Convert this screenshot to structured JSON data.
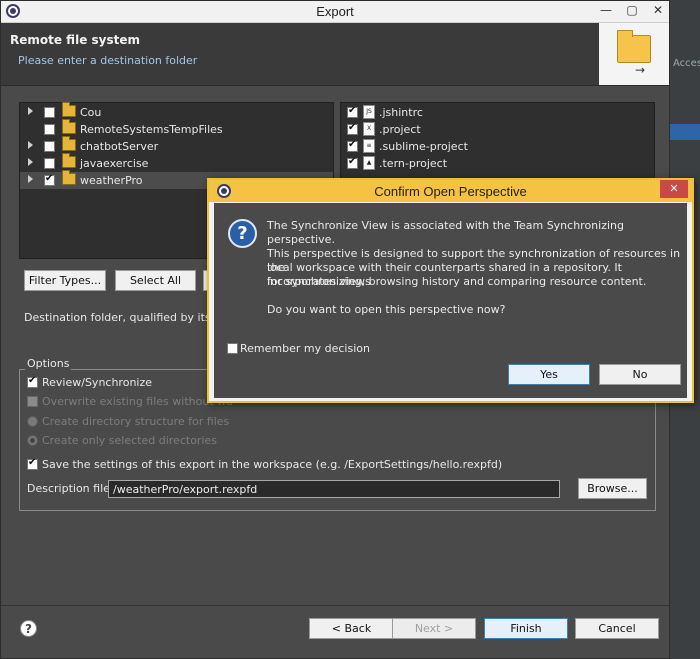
{
  "window": {
    "title": "Export",
    "controls": [
      "—",
      "▢",
      "✕"
    ]
  },
  "header": {
    "title": "Remote file system",
    "subtitle": "Please enter a destination folder"
  },
  "background": {
    "partial_text": "Acces"
  },
  "tree": {
    "items": [
      {
        "label": "Cou",
        "checked": false,
        "expandable": true
      },
      {
        "label": "RemoteSystemsTempFiles",
        "checked": false,
        "expandable": false
      },
      {
        "label": "chatbotServer",
        "checked": false,
        "expandable": true
      },
      {
        "label": "javaexercise",
        "checked": false,
        "expandable": true
      },
      {
        "label": "weatherPro",
        "checked": true,
        "expandable": true,
        "selected": true
      }
    ]
  },
  "files": {
    "items": [
      {
        "label": ".jshintrc",
        "checked": true,
        "icon": "js-file-icon"
      },
      {
        "label": ".project",
        "checked": true,
        "icon": "xml-file-icon"
      },
      {
        "label": ".sublime-project",
        "checked": true,
        "icon": "text-file-icon"
      },
      {
        "label": ".tern-project",
        "checked": true,
        "icon": "tern-file-icon"
      }
    ]
  },
  "buttons": {
    "filter_types": "Filter Types...",
    "select_all": "Select All",
    "back": "< Back",
    "next": "Next >",
    "finish": "Finish",
    "cancel": "Cancel",
    "browse": "Browse..."
  },
  "destination_label": "Destination folder, qualified by its re",
  "options": {
    "legend": "Options",
    "review_sync": "Review/Synchronize",
    "overwrite": "Overwrite existing files without wa",
    "create_structure": "Create directory structure for files",
    "create_selected": "Create only selected directories",
    "save_settings": "Save the settings of this export in the workspace (e.g. /ExportSettings/hello.rexpfd)",
    "description_label": "Description file:",
    "description_value": "/weatherPro/export.rexpfd"
  },
  "dialog": {
    "title": "Confirm Open Perspective",
    "close": "✕",
    "line1": "The Synchronize View is associated with the Team Synchronizing perspective.",
    "para2_l1": "This perspective is designed to support the synchronization of resources in the",
    "para2_l2": "local workspace with their counterparts shared in a repository. It incorporates views",
    "para2_l3": "for synchronizing, browsing history and comparing resource content.",
    "question": "Do you want to open this perspective now?",
    "remember": "Remember my decision",
    "yes": "Yes",
    "no": "No"
  },
  "help_icon": "?",
  "colors": {
    "dialog_border": "#f0c032",
    "accent": "#3c7fb1",
    "panel": "#4a4a4a"
  }
}
